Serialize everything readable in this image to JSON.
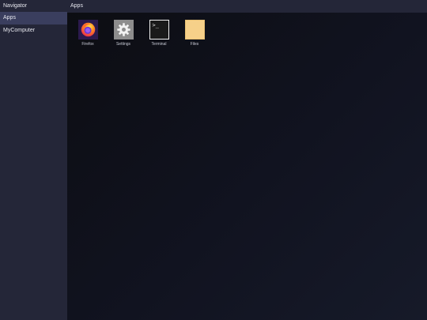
{
  "sidebar": {
    "header": "Navigator",
    "items": [
      {
        "label": "Apps",
        "active": true
      },
      {
        "label": "MyComputer",
        "active": false
      }
    ]
  },
  "main": {
    "title": "Apps",
    "apps": [
      {
        "label": "Firefox",
        "icon": "firefox-icon"
      },
      {
        "label": "Settings",
        "icon": "gear-icon"
      },
      {
        "label": "Terminal",
        "icon": "terminal-icon",
        "glyph": ">_"
      },
      {
        "label": "Files",
        "icon": "folder-icon"
      }
    ]
  },
  "colors": {
    "sidebar_bg": "#242638",
    "active_item_bg": "#3a3e5e",
    "desktop_bg": "#111320",
    "folder": "#f6d089"
  }
}
